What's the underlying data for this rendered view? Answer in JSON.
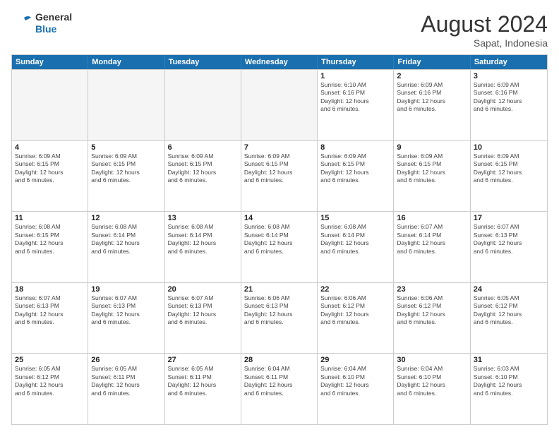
{
  "logo": {
    "line1": "General",
    "line2": "Blue"
  },
  "title": "August 2024",
  "subtitle": "Sapat, Indonesia",
  "header_days": [
    "Sunday",
    "Monday",
    "Tuesday",
    "Wednesday",
    "Thursday",
    "Friday",
    "Saturday"
  ],
  "weeks": [
    [
      {
        "day": "",
        "info": "",
        "empty": true
      },
      {
        "day": "",
        "info": "",
        "empty": true
      },
      {
        "day": "",
        "info": "",
        "empty": true
      },
      {
        "day": "",
        "info": "",
        "empty": true
      },
      {
        "day": "1",
        "info": "Sunrise: 6:10 AM\nSunset: 6:16 PM\nDaylight: 12 hours\nand 6 minutes.",
        "empty": false
      },
      {
        "day": "2",
        "info": "Sunrise: 6:09 AM\nSunset: 6:16 PM\nDaylight: 12 hours\nand 6 minutes.",
        "empty": false
      },
      {
        "day": "3",
        "info": "Sunrise: 6:09 AM\nSunset: 6:16 PM\nDaylight: 12 hours\nand 6 minutes.",
        "empty": false
      }
    ],
    [
      {
        "day": "4",
        "info": "Sunrise: 6:09 AM\nSunset: 6:15 PM\nDaylight: 12 hours\nand 6 minutes.",
        "empty": false
      },
      {
        "day": "5",
        "info": "Sunrise: 6:09 AM\nSunset: 6:15 PM\nDaylight: 12 hours\nand 6 minutes.",
        "empty": false
      },
      {
        "day": "6",
        "info": "Sunrise: 6:09 AM\nSunset: 6:15 PM\nDaylight: 12 hours\nand 6 minutes.",
        "empty": false
      },
      {
        "day": "7",
        "info": "Sunrise: 6:09 AM\nSunset: 6:15 PM\nDaylight: 12 hours\nand 6 minutes.",
        "empty": false
      },
      {
        "day": "8",
        "info": "Sunrise: 6:09 AM\nSunset: 6:15 PM\nDaylight: 12 hours\nand 6 minutes.",
        "empty": false
      },
      {
        "day": "9",
        "info": "Sunrise: 6:09 AM\nSunset: 6:15 PM\nDaylight: 12 hours\nand 6 minutes.",
        "empty": false
      },
      {
        "day": "10",
        "info": "Sunrise: 6:09 AM\nSunset: 6:15 PM\nDaylight: 12 hours\nand 6 minutes.",
        "empty": false
      }
    ],
    [
      {
        "day": "11",
        "info": "Sunrise: 6:08 AM\nSunset: 6:15 PM\nDaylight: 12 hours\nand 6 minutes.",
        "empty": false
      },
      {
        "day": "12",
        "info": "Sunrise: 6:08 AM\nSunset: 6:14 PM\nDaylight: 12 hours\nand 6 minutes.",
        "empty": false
      },
      {
        "day": "13",
        "info": "Sunrise: 6:08 AM\nSunset: 6:14 PM\nDaylight: 12 hours\nand 6 minutes.",
        "empty": false
      },
      {
        "day": "14",
        "info": "Sunrise: 6:08 AM\nSunset: 6:14 PM\nDaylight: 12 hours\nand 6 minutes.",
        "empty": false
      },
      {
        "day": "15",
        "info": "Sunrise: 6:08 AM\nSunset: 6:14 PM\nDaylight: 12 hours\nand 6 minutes.",
        "empty": false
      },
      {
        "day": "16",
        "info": "Sunrise: 6:07 AM\nSunset: 6:14 PM\nDaylight: 12 hours\nand 6 minutes.",
        "empty": false
      },
      {
        "day": "17",
        "info": "Sunrise: 6:07 AM\nSunset: 6:13 PM\nDaylight: 12 hours\nand 6 minutes.",
        "empty": false
      }
    ],
    [
      {
        "day": "18",
        "info": "Sunrise: 6:07 AM\nSunset: 6:13 PM\nDaylight: 12 hours\nand 6 minutes.",
        "empty": false
      },
      {
        "day": "19",
        "info": "Sunrise: 6:07 AM\nSunset: 6:13 PM\nDaylight: 12 hours\nand 6 minutes.",
        "empty": false
      },
      {
        "day": "20",
        "info": "Sunrise: 6:07 AM\nSunset: 6:13 PM\nDaylight: 12 hours\nand 6 minutes.",
        "empty": false
      },
      {
        "day": "21",
        "info": "Sunrise: 6:06 AM\nSunset: 6:13 PM\nDaylight: 12 hours\nand 6 minutes.",
        "empty": false
      },
      {
        "day": "22",
        "info": "Sunrise: 6:06 AM\nSunset: 6:12 PM\nDaylight: 12 hours\nand 6 minutes.",
        "empty": false
      },
      {
        "day": "23",
        "info": "Sunrise: 6:06 AM\nSunset: 6:12 PM\nDaylight: 12 hours\nand 6 minutes.",
        "empty": false
      },
      {
        "day": "24",
        "info": "Sunrise: 6:05 AM\nSunset: 6:12 PM\nDaylight: 12 hours\nand 6 minutes.",
        "empty": false
      }
    ],
    [
      {
        "day": "25",
        "info": "Sunrise: 6:05 AM\nSunset: 6:12 PM\nDaylight: 12 hours\nand 6 minutes.",
        "empty": false
      },
      {
        "day": "26",
        "info": "Sunrise: 6:05 AM\nSunset: 6:11 PM\nDaylight: 12 hours\nand 6 minutes.",
        "empty": false
      },
      {
        "day": "27",
        "info": "Sunrise: 6:05 AM\nSunset: 6:11 PM\nDaylight: 12 hours\nand 6 minutes.",
        "empty": false
      },
      {
        "day": "28",
        "info": "Sunrise: 6:04 AM\nSunset: 6:11 PM\nDaylight: 12 hours\nand 6 minutes.",
        "empty": false
      },
      {
        "day": "29",
        "info": "Sunrise: 6:04 AM\nSunset: 6:10 PM\nDaylight: 12 hours\nand 6 minutes.",
        "empty": false
      },
      {
        "day": "30",
        "info": "Sunrise: 6:04 AM\nSunset: 6:10 PM\nDaylight: 12 hours\nand 6 minutes.",
        "empty": false
      },
      {
        "day": "31",
        "info": "Sunrise: 6:03 AM\nSunset: 6:10 PM\nDaylight: 12 hours\nand 6 minutes.",
        "empty": false
      }
    ]
  ]
}
